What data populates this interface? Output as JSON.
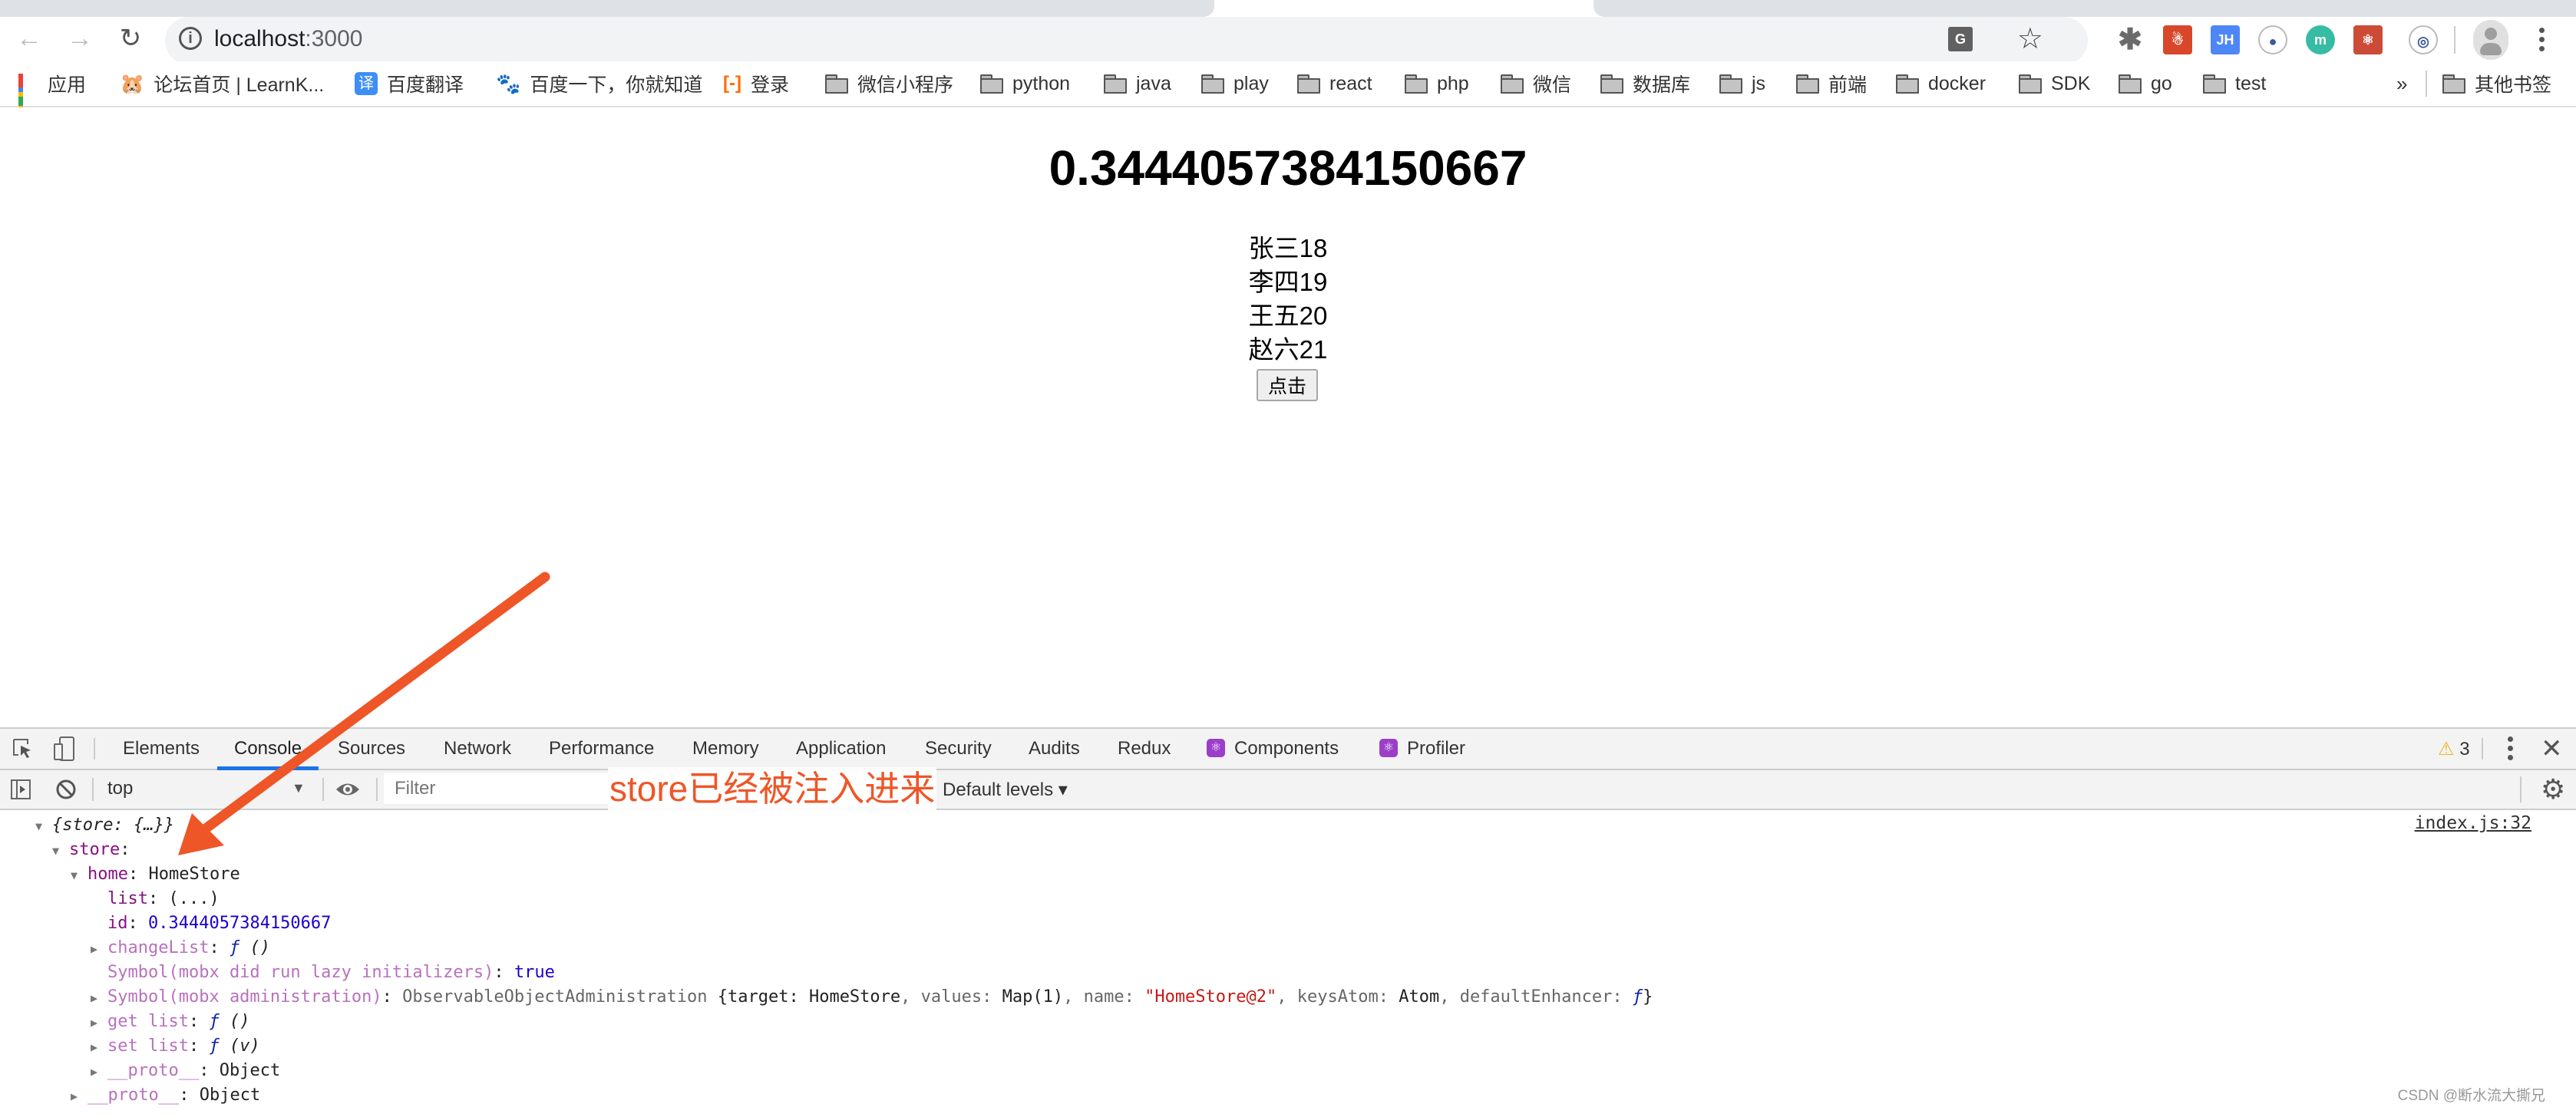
{
  "browser": {
    "url_host": "localhost",
    "url_port": ":3000",
    "nav": {
      "back": "←",
      "forward": "→",
      "reload": "↻"
    },
    "extensions": [
      {
        "name": "gear-extension",
        "label": "✱",
        "color": "#6b6b6b"
      },
      {
        "name": "red-extension",
        "label": "☃",
        "color": "#d9472b"
      },
      {
        "name": "jh-extension",
        "label": "JH",
        "color": "#4e86f5"
      },
      {
        "name": "chat-extension",
        "label": "●",
        "color": "#ffffff"
      },
      {
        "name": "m-extension",
        "label": "m",
        "color": "#36bca3"
      },
      {
        "name": "react-extension",
        "label": "⚛",
        "color": "#cc4b37"
      },
      {
        "name": "ring-extension",
        "label": "◎",
        "color": "#ffffff"
      }
    ],
    "bookmarks": [
      {
        "label": "应用",
        "icon": "apps"
      },
      {
        "label": "论坛首页 | LearnK...",
        "icon": "site"
      },
      {
        "label": "百度翻译",
        "icon": "translate"
      },
      {
        "label": "百度一下，你就知道",
        "icon": "baidu"
      },
      {
        "label": "登录",
        "icon": "login"
      },
      {
        "label": "微信小程序",
        "icon": "folder"
      },
      {
        "label": "python",
        "icon": "folder"
      },
      {
        "label": "java",
        "icon": "folder"
      },
      {
        "label": "play",
        "icon": "folder"
      },
      {
        "label": "react",
        "icon": "folder"
      },
      {
        "label": "php",
        "icon": "folder"
      },
      {
        "label": "微信",
        "icon": "folder"
      },
      {
        "label": "数据库",
        "icon": "folder"
      },
      {
        "label": "js",
        "icon": "folder"
      },
      {
        "label": "前端",
        "icon": "folder"
      },
      {
        "label": "docker",
        "icon": "folder"
      },
      {
        "label": "SDK",
        "icon": "folder"
      },
      {
        "label": "go",
        "icon": "folder"
      },
      {
        "label": "test",
        "icon": "folder"
      }
    ],
    "bookmarks_overflow": "»",
    "other_bookmarks": "其他书签"
  },
  "page": {
    "heading": "0.3444057384150667",
    "people": [
      "张三18",
      "李四19",
      "王五20",
      "赵六21"
    ],
    "button_label": "点击"
  },
  "devtools": {
    "tabs": [
      {
        "label": "Elements",
        "active": false
      },
      {
        "label": "Console",
        "active": true
      },
      {
        "label": "Sources",
        "active": false
      },
      {
        "label": "Network",
        "active": false
      },
      {
        "label": "Performance",
        "active": false
      },
      {
        "label": "Memory",
        "active": false
      },
      {
        "label": "Application",
        "active": false
      },
      {
        "label": "Security",
        "active": false
      },
      {
        "label": "Audits",
        "active": false
      },
      {
        "label": "Redux",
        "active": false
      },
      {
        "label": "Components",
        "active": false,
        "react": true
      },
      {
        "label": "Profiler",
        "active": false,
        "react": true
      }
    ],
    "warning_count": "3",
    "context": "top",
    "filter_placeholder": "Filter",
    "levels": "Default levels ▾",
    "source_link": "index.js:32",
    "console": {
      "root": "{store: {…}}",
      "store_key": "store",
      "home_key": "home",
      "home_value": "HomeStore",
      "list_key": "list",
      "list_value": "(...)",
      "id_key": "id",
      "id_value": "0.3444057384150667",
      "changeList_key": "changeList",
      "fn_f": "ƒ",
      "fn_args_empty": "()",
      "fn_args_v": "(v)",
      "lazy_key": "Symbol(mobx did run lazy initializers)",
      "lazy_value": "true",
      "admin_key": "Symbol(mobx administration)",
      "admin_class": "ObservableObjectAdministration",
      "admin_open": "{target: ",
      "admin_target": "HomeStore",
      "admin_values_key": ", values: ",
      "admin_values": "Map(1)",
      "admin_name_key": ", name: ",
      "admin_name": "\"HomeStore@2\"",
      "admin_keysatom_key": ", keysAtom: ",
      "admin_keysatom": "Atom",
      "admin_enh_key": ", defaultEnhancer: ",
      "admin_close": "}",
      "get_list_key": "get list",
      "set_list_key": "set list",
      "proto_key": "__proto__",
      "proto_value": "Object"
    }
  },
  "annotation": {
    "text": "store已经被注入进来",
    "color": "#ee5628"
  },
  "watermark": "CSDN @断水流大撕兄"
}
